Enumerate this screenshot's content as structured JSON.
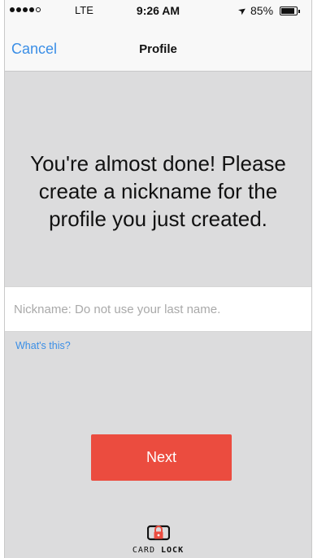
{
  "status_bar": {
    "carrier": "LTE",
    "time": "9:26 AM",
    "battery_percent": "85%",
    "signal_bars": 4,
    "signal_total": 5
  },
  "nav": {
    "cancel_label": "Cancel",
    "title": "Profile"
  },
  "main": {
    "headline": "You're almost done! Please create a nickname for the profile you just created.",
    "nickname_placeholder": "Nickname: Do not use your last name.",
    "nickname_value": "",
    "whats_this_label": "What's this?",
    "next_label": "Next"
  },
  "brand": {
    "name_part1": "CARD",
    "name_part2": "LOCK",
    "accent_color": "#eb4c3f"
  },
  "colors": {
    "background": "#dcdcdd",
    "link": "#3a8ee6",
    "button": "#eb4c3f"
  }
}
